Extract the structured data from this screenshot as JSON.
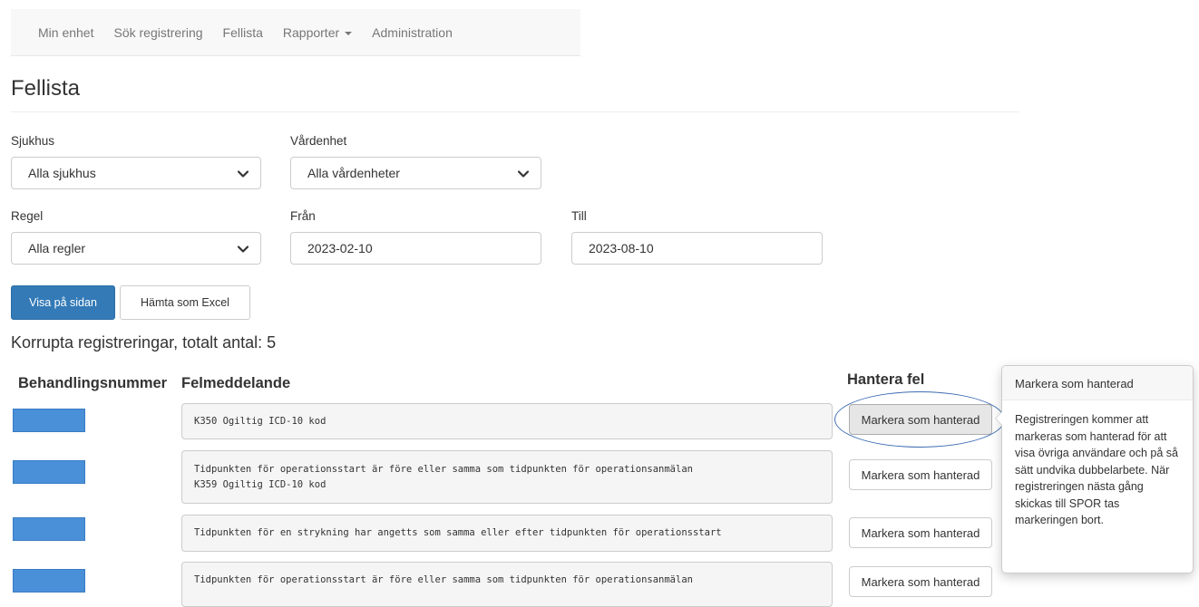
{
  "nav": {
    "items": [
      {
        "label": "Min enhet"
      },
      {
        "label": "Sök registrering"
      },
      {
        "label": "Fellista"
      },
      {
        "label": "Rapporter"
      },
      {
        "label": "Administration"
      }
    ]
  },
  "page": {
    "title": "Fellista"
  },
  "filters": {
    "sjukhus": {
      "label": "Sjukhus",
      "value": "Alla sjukhus"
    },
    "vardenhet": {
      "label": "Vårdenhet",
      "value": "Alla vårdenheter"
    },
    "regel": {
      "label": "Regel",
      "value": "Alla regler"
    },
    "fran": {
      "label": "Från",
      "value": "2023-02-10"
    },
    "till": {
      "label": "Till",
      "value": "2023-08-10"
    }
  },
  "actions": {
    "show_label": "Visa på sidan",
    "excel_label": "Hämta som Excel"
  },
  "summary": {
    "text": "Korrupta registreringar, totalt antal: 5"
  },
  "table": {
    "headers": [
      "Behandlingsnummer",
      "Felmeddelande",
      "Hantera fel"
    ],
    "rows": [
      {
        "message_lines": [
          "K350 Ogiltig ICD-10 kod"
        ],
        "button": "Markera som hanterad"
      },
      {
        "message_lines": [
          "Tidpunkten för operationsstart är före eller samma som tidpunkten för operationsanmälan",
          "K359 Ogiltig ICD-10 kod"
        ],
        "button": "Markera som hanterad"
      },
      {
        "message_lines": [
          "Tidpunkten för en strykning har angetts som samma eller efter tidpunkten för operationsstart"
        ],
        "button": "Markera som hanterad"
      },
      {
        "message_lines": [
          "Tidpunkten för operationsstart är före eller samma som tidpunkten för operationsanmälan"
        ],
        "button": "Markera som hanterad"
      }
    ]
  },
  "popover": {
    "title": "Markera som hanterad",
    "body": "Registreringen kommer att markeras som hanterad för att visa övriga användare och på så sätt undvika dubbelarbete. När registreringen nästa gång skickas till SPOR tas markeringen bort."
  },
  "colors": {
    "primary": "#337ab7",
    "redacted_bar": "#4a90d9",
    "highlight": "#3f6db3"
  }
}
